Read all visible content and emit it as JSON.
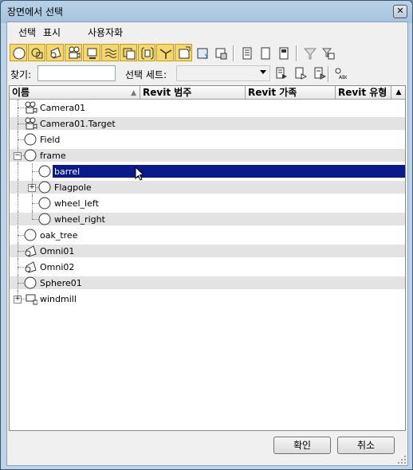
{
  "window": {
    "title": "장면에서 선택"
  },
  "menu": [
    "선택",
    "표시",
    "사용자화"
  ],
  "toolbar": {
    "filters": [
      {
        "icon": "geometry-icon",
        "on": true
      },
      {
        "icon": "shape-icon",
        "on": true
      },
      {
        "icon": "light-icon",
        "on": true
      },
      {
        "icon": "camera-icon",
        "on": true
      },
      {
        "icon": "helper-icon",
        "on": true
      },
      {
        "icon": "spacewarp-icon",
        "on": true
      },
      {
        "icon": "group-icon",
        "on": true
      },
      {
        "icon": "xref-icon",
        "on": true
      },
      {
        "icon": "bone-icon",
        "on": true
      },
      {
        "icon": "container-icon",
        "on": true
      },
      {
        "icon": "frozen-icon",
        "on": false
      },
      {
        "icon": "hidden-icon",
        "on": false
      }
    ],
    "actions": [
      "select-all-icon",
      "select-none-icon",
      "select-invert-icon"
    ],
    "extra": [
      "filter-icon",
      "filter-settings-icon"
    ]
  },
  "find": {
    "label": "찾기:",
    "value": ""
  },
  "selection_set": {
    "label": "선택 세트:",
    "value": ""
  },
  "columns": [
    "이름",
    "Revit 범주",
    "Revit 가족",
    "Revit 유형"
  ],
  "rows": [
    {
      "name": "Camera01",
      "level": 0,
      "icon": "camera",
      "expander": ""
    },
    {
      "name": "Camera01.Target",
      "level": 0,
      "icon": "camera",
      "expander": ""
    },
    {
      "name": "Field",
      "level": 0,
      "icon": "sphere",
      "expander": ""
    },
    {
      "name": "frame",
      "level": 0,
      "icon": "sphere",
      "expander": "−"
    },
    {
      "name": "barrel",
      "level": 1,
      "icon": "sphere",
      "expander": "",
      "selected": true
    },
    {
      "name": "Flagpole",
      "level": 1,
      "icon": "sphere",
      "expander": "+"
    },
    {
      "name": "wheel_left",
      "level": 1,
      "icon": "sphere",
      "expander": ""
    },
    {
      "name": "wheel_right",
      "level": 1,
      "icon": "sphere",
      "expander": ""
    },
    {
      "name": "oak_tree",
      "level": 0,
      "icon": "sphere",
      "expander": ""
    },
    {
      "name": "Omni01",
      "level": 0,
      "icon": "light",
      "expander": ""
    },
    {
      "name": "Omni02",
      "level": 0,
      "icon": "light",
      "expander": ""
    },
    {
      "name": "Sphere01",
      "level": 0,
      "icon": "sphere",
      "expander": ""
    },
    {
      "name": "windmill",
      "level": 0,
      "icon": "helper",
      "expander": "+"
    }
  ],
  "buttons": {
    "ok": "확인",
    "cancel": "취소"
  }
}
